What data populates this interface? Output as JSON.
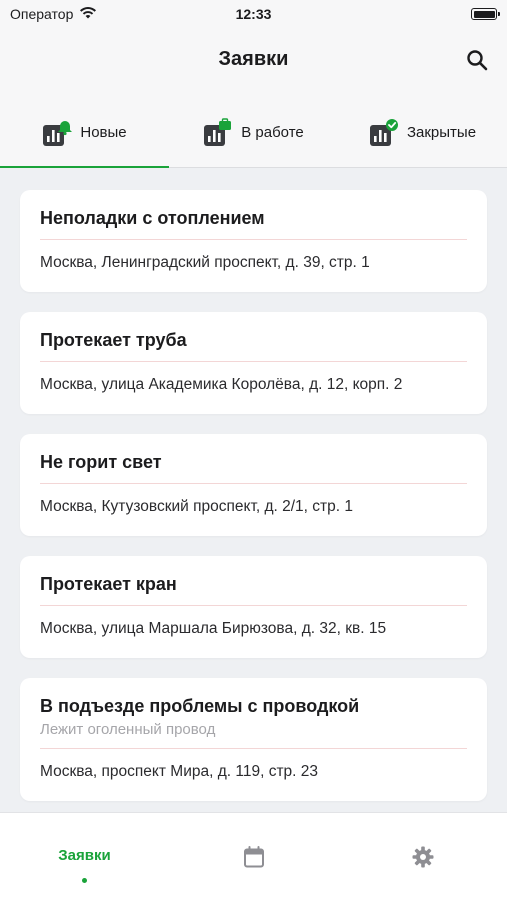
{
  "status_bar": {
    "carrier": "Оператор",
    "time": "12:33"
  },
  "navbar": {
    "title": "Заявки",
    "search_icon": "search-icon"
  },
  "tabs": [
    {
      "label": "Новые",
      "icon": "chart-bell-icon",
      "active": true
    },
    {
      "label": "В работе",
      "icon": "chart-briefcase-icon",
      "active": false
    },
    {
      "label": "Закрытые",
      "icon": "chart-check-icon",
      "active": false
    }
  ],
  "requests": [
    {
      "title": "Неполадки с отоплением",
      "address": "Москва, Ленинградский проспект, д. 39, стр. 1"
    },
    {
      "title": "Протекает труба",
      "address": "Москва, улица Академика Королёва, д. 12, корп. 2"
    },
    {
      "title": "Не горит свет",
      "address": "Москва, Кутузовский проспект, д. 2/1, стр. 1"
    },
    {
      "title": "Протекает кран",
      "address": "Москва, улица Маршала Бирюзова, д. 32, кв. 15"
    },
    {
      "title": "В подъезде проблемы с проводкой",
      "description": "Лежит оголенный провод",
      "address": "Москва, проспект Мира, д. 119, стр. 23"
    }
  ],
  "bottom_bar": {
    "items": [
      {
        "label": "Заявки",
        "icon": "list-icon",
        "active": true
      },
      {
        "icon": "calendar-icon"
      },
      {
        "icon": "gear-icon"
      }
    ]
  },
  "colors": {
    "accent": "#1aa33a",
    "icon_dark": "#3a3c40",
    "inactive_icon": "#8e8e93"
  }
}
